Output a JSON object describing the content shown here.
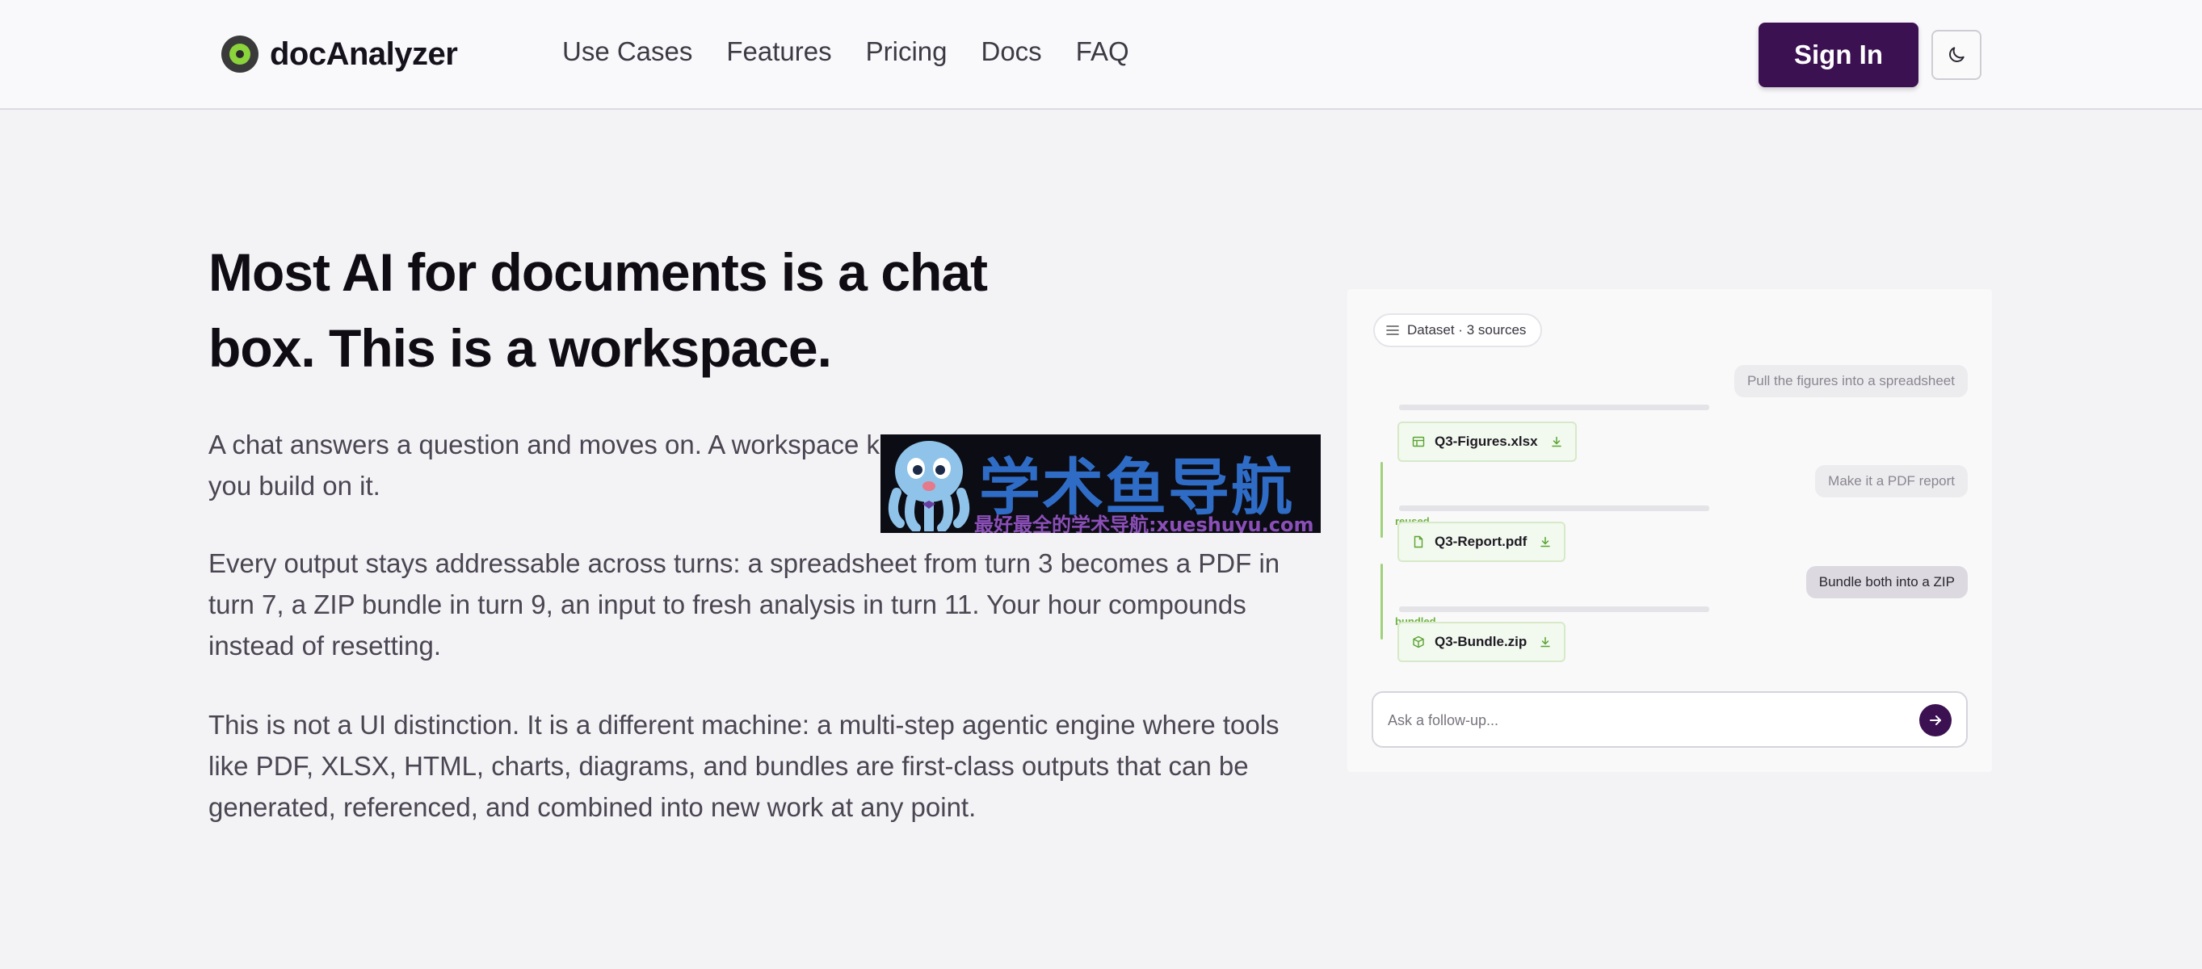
{
  "header": {
    "brand": "docAnalyzer",
    "nav": [
      "Use Cases",
      "Features",
      "Pricing",
      "Docs",
      "FAQ"
    ],
    "sign_in": "Sign In",
    "theme_icon": "moon-icon"
  },
  "hero": {
    "title": "Most AI for documents is a chat box. This is a workspace.",
    "p1": "A chat answers a question and moves on. A workspace keeps what you produce and lets you build on it.",
    "p2": "Every output stays addressable across turns: a spreadsheet from turn 3 becomes a PDF in turn 7, a ZIP bundle in turn 9, an input to fresh analysis in turn 11. Your hour compounds instead of resetting.",
    "p3": "This is not a UI distinction. It is a different machine: a multi-step agentic engine where tools like PDF, XLSX, HTML, charts, diagrams, and bundles are first-class outputs that can be generated, referenced, and combined into new work at any point."
  },
  "watermark": {
    "big": "学术鱼导航",
    "small": "最好最全的学术导航:xueshuyu.com"
  },
  "workspace": {
    "dataset_chip": "Dataset · 3 sources",
    "messages": [
      "Pull the figures into a spreadsheet",
      "Make it a PDF report",
      "Bundle both into a ZIP"
    ],
    "files": [
      {
        "name": "Q3-Figures.xlsx",
        "icon": "spreadsheet-icon",
        "tag": ""
      },
      {
        "name": "Q3-Report.pdf",
        "icon": "file-icon",
        "tag": "reused"
      },
      {
        "name": "Q3-Bundle.zip",
        "icon": "package-icon",
        "tag": "bundled"
      }
    ],
    "followup_placeholder": "Ask a follow-up..."
  },
  "colors": {
    "brand": "#3c1152",
    "accent_green": "#8bd43c",
    "background": "#f3f2f5"
  }
}
